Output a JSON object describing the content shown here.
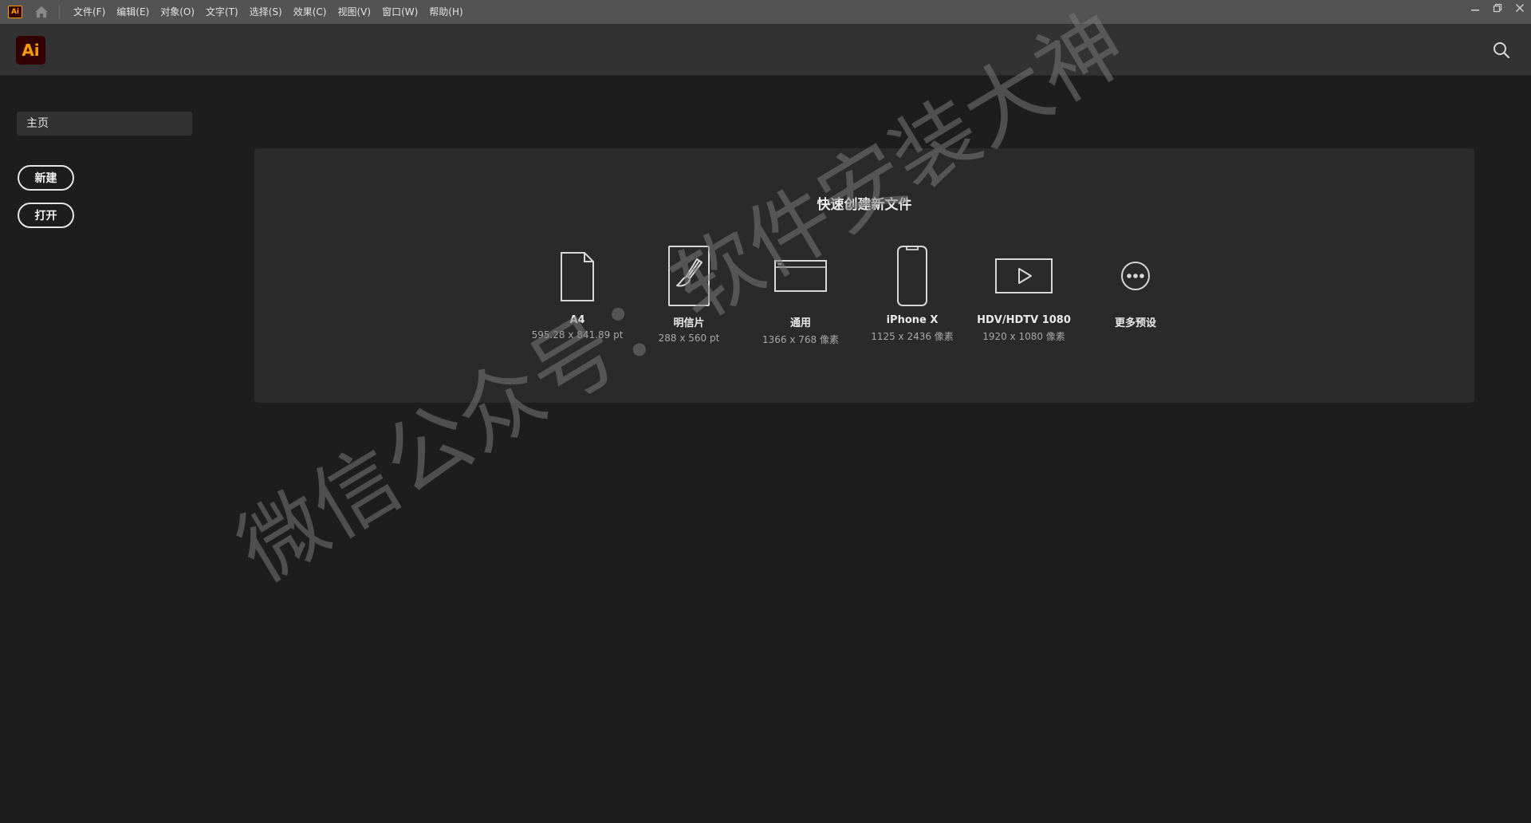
{
  "app": {
    "badge": "Ai",
    "logo": "Ai",
    "accent": "#ff9a00"
  },
  "menubar": {
    "items": [
      "文件(F)",
      "编辑(E)",
      "对象(O)",
      "文字(T)",
      "选择(S)",
      "效果(C)",
      "视图(V)",
      "窗口(W)",
      "帮助(H)"
    ]
  },
  "sidebar": {
    "home": "主页",
    "new_label": "新建",
    "open_label": "打开"
  },
  "quick_create": {
    "title": "快速创建新文件",
    "presets": [
      {
        "name": "A4",
        "size": "595.28 x 841.89 pt",
        "icon": "document-icon"
      },
      {
        "name": "明信片",
        "size": "288 x 560 pt",
        "icon": "brush-icon"
      },
      {
        "name": "通用",
        "size": "1366 x 768 像素",
        "icon": "browser-icon"
      },
      {
        "name": "iPhone X",
        "size": "1125 x 2436 像素",
        "icon": "phone-icon"
      },
      {
        "name": "HDV/HDTV 1080",
        "size": "1920 x 1080 像素",
        "icon": "video-icon"
      },
      {
        "name": "更多预设",
        "size": "",
        "icon": "more-icon"
      }
    ]
  },
  "watermark": "微信公众号：软件安装大神"
}
